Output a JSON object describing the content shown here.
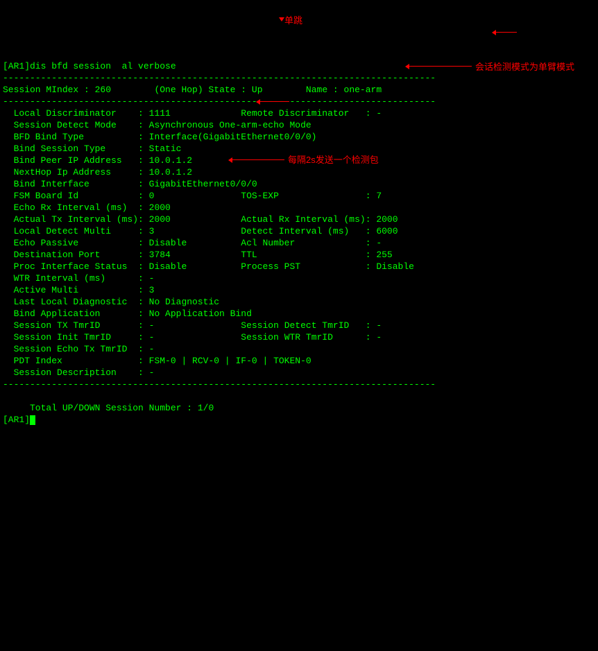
{
  "command": "[AR1]dis bfd session  al verbose",
  "divider": "--------------------------------------------------------------------------------",
  "header": {
    "mindex_label": "Session MIndex : ",
    "mindex": "260",
    "hop_label": "(One Hop) State : ",
    "state": "Up",
    "name_label": "Name : ",
    "name": "one-arm"
  },
  "fields": {
    "local_disc_label": "  Local Discriminator    : ",
    "local_disc": "1111",
    "remote_disc_label": "Remote Discriminator   : ",
    "remote_disc": "-",
    "detect_mode_label": "  Session Detect Mode    : ",
    "detect_mode": "Asynchronous One-arm-echo Mode",
    "bfd_bind_label": "  BFD Bind Type          : ",
    "bfd_bind": "Interface(GigabitEthernet0/0/0)",
    "bind_session_label": "  Bind Session Type      : ",
    "bind_session": "Static",
    "bind_peer_label": "  Bind Peer IP Address   : ",
    "bind_peer": "10.0.1.2",
    "nexthop_label": "  NextHop Ip Address     : ",
    "nexthop": "10.0.1.2",
    "bind_if_label": "  Bind Interface         : ",
    "bind_if": "GigabitEthernet0/0/0",
    "fsm_label": "  FSM Board Id           : ",
    "fsm": "0",
    "tos_label": "TOS-EXP                : ",
    "tos": "7",
    "echo_rx_label": "  Echo Rx Interval (ms)  : ",
    "echo_rx": "2000",
    "actual_tx_label": "  Actual Tx Interval (ms): ",
    "actual_tx": "2000",
    "actual_rx_label": "Actual Rx Interval (ms): ",
    "actual_rx": "2000",
    "local_multi_label": "  Local Detect Multi     : ",
    "local_multi": "3",
    "detect_int_label": "Detect Interval (ms)   : ",
    "detect_int": "6000",
    "echo_passive_label": "  Echo Passive           : ",
    "echo_passive": "Disable",
    "acl_label": "Acl Number             : ",
    "acl": "-",
    "dest_port_label": "  Destination Port       : ",
    "dest_port": "3784",
    "ttl_label": "TTL                    : ",
    "ttl": "255",
    "proc_if_label": "  Proc Interface Status  : ",
    "proc_if": "Disable",
    "proc_pst_label": "Process PST            : ",
    "proc_pst": "Disable",
    "wtr_label": "  WTR Interval (ms)      : ",
    "wtr": "-",
    "active_multi_label": "  Active Multi           : ",
    "active_multi": "3",
    "last_diag_label": "  Last Local Diagnostic  : ",
    "last_diag": "No Diagnostic",
    "bind_app_label": "  Bind Application       : ",
    "bind_app": "No Application Bind",
    "tx_tmr_label": "  Session TX TmrID       : ",
    "tx_tmr": "-",
    "detect_tmr_label": "Session Detect TmrID   : ",
    "detect_tmr": "-",
    "init_tmr_label": "  Session Init TmrID     : ",
    "init_tmr": "-",
    "wtr_tmr_label": "Session WTR TmrID      : ",
    "wtr_tmr": "-",
    "echo_tx_label": "  Session Echo Tx TmrID  : ",
    "echo_tx_tmr": "-",
    "pdt_label": "  PDT Index              : ",
    "pdt": "FSM-0 | RCV-0 | IF-0 | TOKEN-0",
    "desc_label": "  Session Description    : ",
    "desc": "-"
  },
  "footer": {
    "total_label": "     Total UP/DOWN Session Number : ",
    "total": "1/0",
    "prompt": "[AR1]"
  },
  "annotations": {
    "single_hop": "单跳",
    "mode_desc": "会话检测模式为单臂模式",
    "interval_desc": "每隔2s发送一个检测包"
  }
}
